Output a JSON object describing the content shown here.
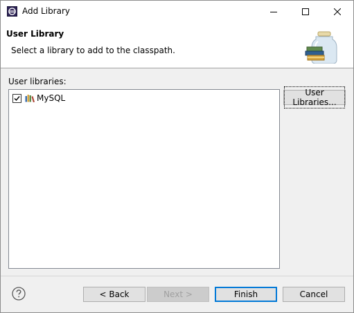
{
  "window": {
    "title": "Add Library",
    "controls": {
      "minimize": "minimize",
      "maximize": "maximize",
      "close": "close"
    }
  },
  "header": {
    "title": "User Library",
    "description": "Select a library to add to the classpath."
  },
  "libraries": {
    "label": "User libraries:",
    "items": [
      {
        "label": "MySQL",
        "checked": true,
        "icon": "library-books-icon"
      }
    ]
  },
  "buttons": {
    "user_libraries": "User Libraries...",
    "back": "< Back",
    "next": "Next >",
    "finish": "Finish",
    "cancel": "Cancel"
  },
  "colors": {
    "default_button_border": "#0078d7",
    "banner_background": "#ffffff",
    "dialog_background": "#f0f0f0"
  }
}
